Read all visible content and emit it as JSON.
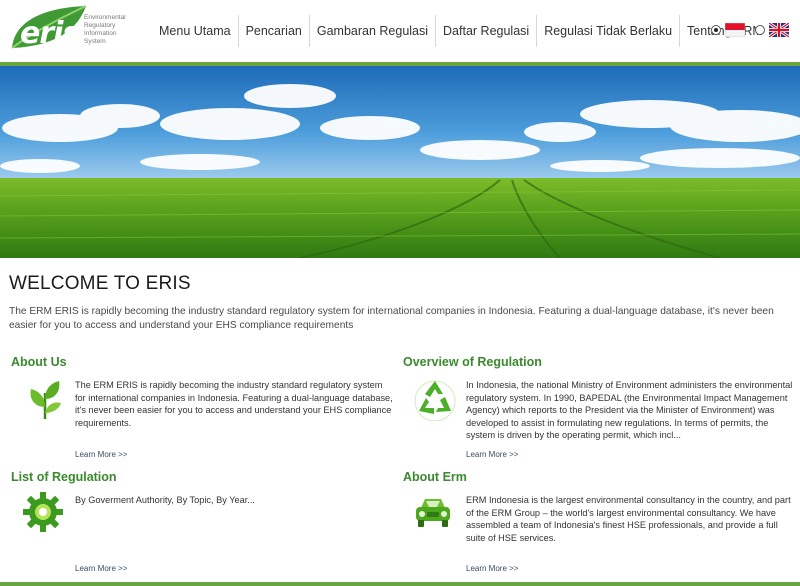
{
  "brand": {
    "logo_word": "eris",
    "logo_tagline": [
      "Environmental",
      "Regulatory",
      "Information",
      "System"
    ]
  },
  "nav": {
    "items": [
      "Menu Utama",
      "Pencarian",
      "Gambaran Regulasi",
      "Daftar Regulasi",
      "Regulasi Tidak Berlaku",
      "Tentang ERM"
    ]
  },
  "language": {
    "options": [
      "Indonesian flag",
      "UK flag"
    ],
    "selected": "Indonesian flag"
  },
  "welcome": {
    "title": "WELCOME TO ERIS",
    "text": "The ERM ERIS is rapidly becoming the industry standard regulatory system for international companies in Indonesia. Featuring a dual-language database, it's never been easier for you to access and understand your EHS compliance requirements"
  },
  "sections": {
    "about_us": {
      "title": "About Us",
      "icon": "leaf-plant-icon",
      "text": "The ERM ERIS is rapidly becoming the industry standard regulatory system for international companies in Indonesia. Featuring a dual-language database, it's never been easier for you to access and understand your EHS compliance requirements.",
      "learn_more": "Learn More >>"
    },
    "overview": {
      "title": "Overview of Regulation",
      "icon": "recycle-icon",
      "text": "In Indonesia, the national Ministry of Environment administers the environmental regulatory system. In 1990, BAPEDAL (the Environmental Impact Management Agency) which reports to the President via the Minister of Environment) was developed to assist in formulating new regulations. In terms of permits, the system is driven by the operating permit, which incl...",
      "learn_more": "Learn More >>"
    },
    "list": {
      "title": "List of Regulation",
      "icon": "green-gear-icon",
      "text": "By Goverment Authority, By Topic, By Year...",
      "learn_more": "Learn More >>"
    },
    "about_erm": {
      "title": "About Erm",
      "icon": "green-car-icon",
      "text": "ERM Indonesia is the largest environmental consultancy in the country, and part of the ERM Group – the world's largest environmental consultancy. We have assembled a team of Indonesia's finest HSE professionals, and provide a full suite of HSE services.",
      "learn_more": "Learn More >>"
    }
  },
  "colors": {
    "accent_green": "#3a8a2e",
    "header_line": "#6aa640"
  }
}
